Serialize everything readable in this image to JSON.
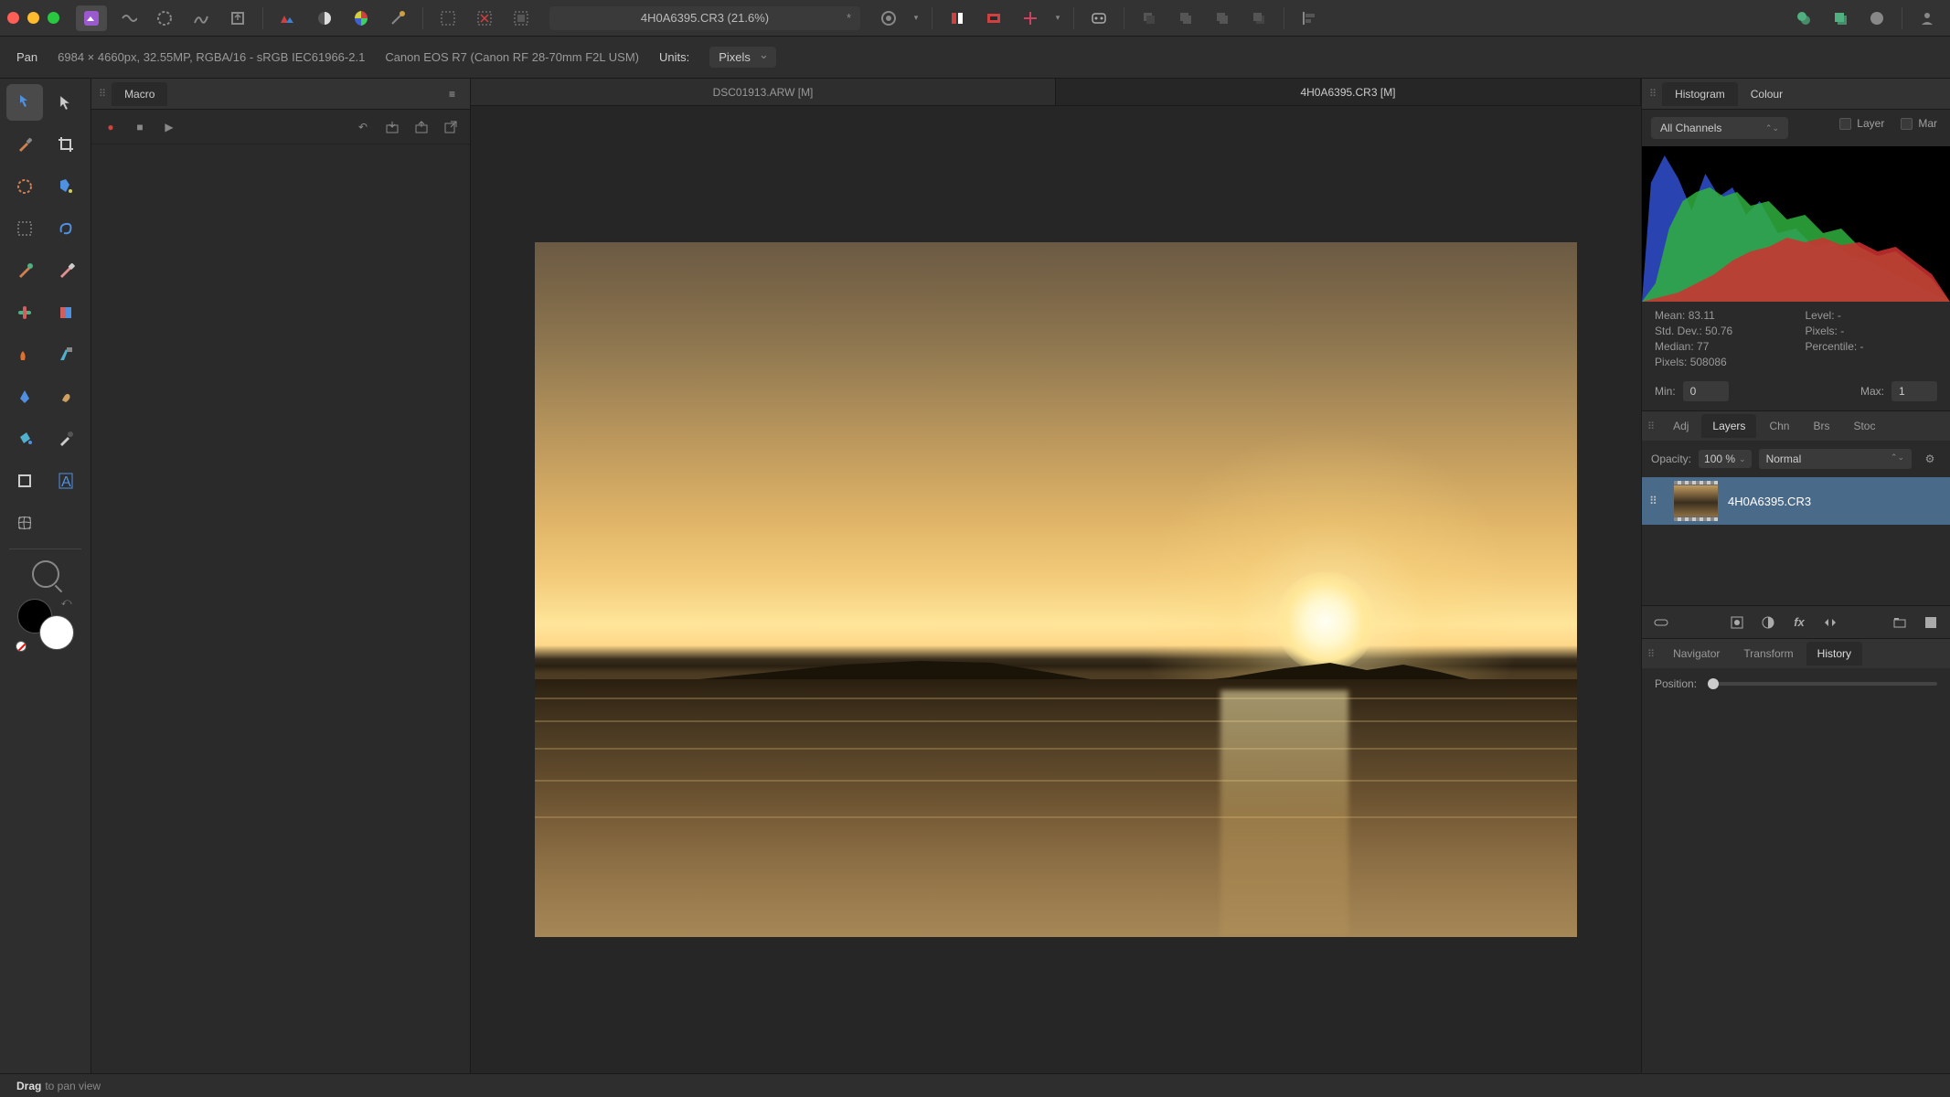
{
  "toolbar": {
    "doc_title": "4H0A6395.CR3 (21.6%)",
    "modified_indicator": "*"
  },
  "context_bar": {
    "tool_name": "Pan",
    "image_info": "6984 × 4660px, 32.55MP, RGBA/16 - sRGB IEC61966-2.1",
    "camera_info": "Canon EOS R7 (Canon RF 28-70mm F2L USM)",
    "units_label": "Units:",
    "units_value": "Pixels"
  },
  "macro_panel": {
    "tab_label": "Macro"
  },
  "doc_tabs": [
    {
      "label": "DSC01913.ARW [M]",
      "active": false
    },
    {
      "label": "4H0A6395.CR3 [M]",
      "active": true
    }
  ],
  "right_panel": {
    "tabs": {
      "histogram": "Histogram",
      "colour": "Colour"
    },
    "channel_select": "All Channels",
    "check_layer": "Layer",
    "check_marquee": "Mar",
    "stats": {
      "mean_label": "Mean:",
      "mean_value": "83.11",
      "std_label": "Std. Dev.:",
      "std_value": "50.76",
      "median_label": "Median:",
      "median_value": "77",
      "pixels_label": "Pixels:",
      "pixels_value": "508086",
      "level_label": "Level:",
      "level_value": "-",
      "px_label": "Pixels:",
      "px_value": "-",
      "pct_label": "Percentile:",
      "pct_value": "-"
    },
    "min_label": "Min:",
    "min_value": "0",
    "max_label": "Max:",
    "max_value": "1",
    "subtabs": {
      "adj": "Adj",
      "layers": "Layers",
      "chn": "Chn",
      "brs": "Brs",
      "stock": "Stoc"
    },
    "opacity_label": "Opacity:",
    "opacity_value": "100 %",
    "blend_mode": "Normal",
    "layer_name": "4H0A6395.CR3",
    "bottom_tabs": {
      "navigator": "Navigator",
      "transform": "Transform",
      "history": "History"
    },
    "position_label": "Position:"
  },
  "status_bar": {
    "action_bold": "Drag",
    "action_rest": "to pan view"
  }
}
